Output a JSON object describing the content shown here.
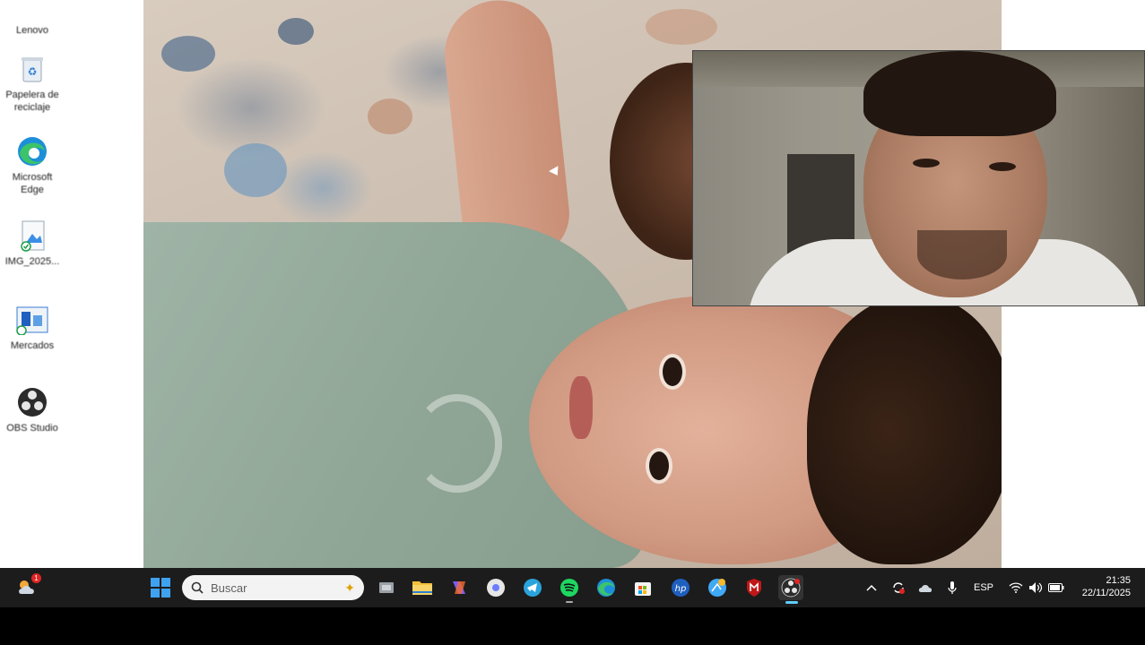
{
  "desktop": {
    "icons": [
      {
        "label": "Lenovo",
        "icon": "lenovo-app-icon"
      },
      {
        "label": "Papelera de reciclaje",
        "icon": "recycle-bin-icon"
      },
      {
        "label": "Microsoft Edge",
        "icon": "edge-icon"
      },
      {
        "label": "IMG_2025...",
        "icon": "image-file-icon"
      },
      {
        "label": "Mercados",
        "icon": "mercados-app-icon"
      },
      {
        "label": "OBS Studio",
        "icon": "obs-icon"
      }
    ]
  },
  "taskbar": {
    "search_placeholder": "Buscar",
    "language": "ESP",
    "time": "21:35",
    "date": "22/11/2025",
    "weather_badge": "1",
    "pinned": [
      "task-view-icon",
      "file-explorer-icon",
      "copilot-icon",
      "chrome-like-icon",
      "telegram-icon",
      "spotify-icon",
      "edge-icon",
      "store-icon",
      "hp-icon",
      "browser-icon",
      "mcafee-icon",
      "obs-icon"
    ],
    "tray": [
      "chevron-up-icon",
      "sync-icon",
      "onedrive-icon",
      "microphone-icon",
      "wifi-icon",
      "volume-icon",
      "battery-icon"
    ]
  },
  "colors": {
    "taskbar_bg": "#1c1c1c",
    "active_indicator": "#60cdff"
  }
}
